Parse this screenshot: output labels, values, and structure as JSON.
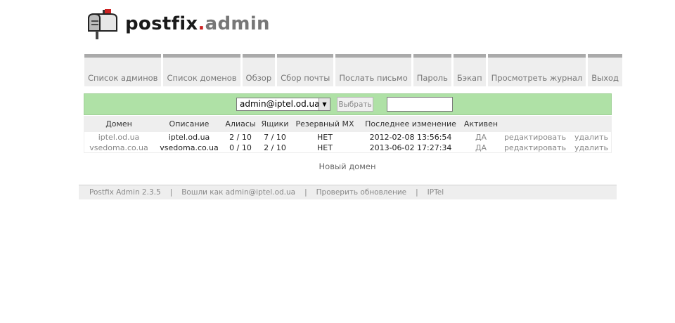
{
  "logo": {
    "main": "postfix",
    "dot": ".",
    "sub": "admin"
  },
  "nav": [
    {
      "label": "Список админов"
    },
    {
      "label": "Список доменов"
    },
    {
      "label": "Обзор"
    },
    {
      "label": "Сбор почты"
    },
    {
      "label": "Послать письмо"
    },
    {
      "label": "Пароль"
    },
    {
      "label": "Бэкап"
    },
    {
      "label": "Просмотреть журнал"
    },
    {
      "label": "Выход"
    }
  ],
  "filter": {
    "selected_admin": "admin@iptel.od.ua",
    "select_button": "Выбрать",
    "search_value": ""
  },
  "table": {
    "headers": {
      "domain": "Домен",
      "description": "Описание",
      "aliases": "Алиасы",
      "mailboxes": "Ящики",
      "backup_mx": "Резервный MX",
      "last_modified": "Последнее изменение",
      "active": "Активен"
    },
    "rows": [
      {
        "domain": "iptel.od.ua",
        "description": "iptel.od.ua",
        "aliases": "2 / 10",
        "mailboxes": "7 / 10",
        "backup_mx": "НЕТ",
        "last_modified": "2012-02-08 13:56:54",
        "active": "ДА",
        "edit": "редактировать",
        "delete": "удалить"
      },
      {
        "domain": "vsedoma.co.ua",
        "description": "vsedoma.co.ua",
        "aliases": "0 / 10",
        "mailboxes": "2 / 10",
        "backup_mx": "НЕТ",
        "last_modified": "2013-06-02 17:27:34",
        "active": "ДА",
        "edit": "редактировать",
        "delete": "удалить"
      }
    ]
  },
  "new_domain": "Новый домен",
  "footer": {
    "version": "Postfix Admin 2.3.5",
    "sep": "|",
    "logged_in": "Вошли как admin@iptel.od.ua",
    "check_update": "Проверить обновление",
    "iptel": "IPTel"
  },
  "colors": {
    "accent_green": "#afe1a6",
    "nav_top": "#aaaaaa",
    "logo_dot": "#cc2222"
  }
}
